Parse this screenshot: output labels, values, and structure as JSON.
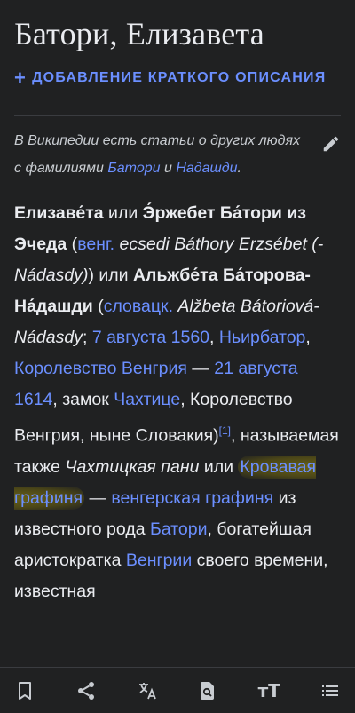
{
  "article": {
    "title": "Батори, Елизавета",
    "add_description": "Добавление краткого описания",
    "add_plus": "+",
    "hatnote": {
      "prefix": "В Википедии есть статьи о других людях с фамилиями ",
      "link1": "Батори",
      "mid": " и ",
      "link2": "Надашди",
      "suffix": "."
    },
    "lead": {
      "s1_bold": "Елизаве́та",
      "s2": " или ",
      "s3_bold": "Э́ржебет Ба́тори из Эчеда",
      "s4": " (",
      "s5_link": "венг.",
      "s6_italic": " ecsedi Báthory Erzsébet (-Nádasdy)",
      "s7": ") или ",
      "s8_bold": "Альжбе́та Ба́торова-На́дашди",
      "s9": " (",
      "s10_link": "словацк.",
      "s11_italic": " Alžbeta Bátoriová-Nádasdy",
      "s12": "; ",
      "s13_link": "7 августа 1560",
      "s14": ", ",
      "s15_link": "Ньирбатор",
      "s16": ", ",
      "s17_link": "Королевство Венгрия",
      "s18": " — ",
      "s19_link": "21 августа 1614",
      "s20": ", замок ",
      "s21_link": "Чахтице",
      "s22": ", Королевство Венгрия, ныне Словакия)",
      "s23_ref": "[1]",
      "s24": ", называемая также ",
      "s25_italic": "Чахтицкая пани",
      "s26": " или ",
      "s27_link_highlight": "Кровавая графиня",
      "s28": " — ",
      "s29_link": "венгерская графиня",
      "s30": " из известного рода ",
      "s31_link": "Батори",
      "s32": ", богатейшая аристократка ",
      "s33_link": "Венгрии",
      "s34": " своего времени, известная"
    }
  },
  "toolbar": {
    "icons": [
      "bookmark-icon",
      "share-icon",
      "translate-icon",
      "find-in-page-icon",
      "text-size-icon",
      "contents-icon"
    ],
    "text_size_label": "тТ"
  },
  "colors": {
    "background": "#202122",
    "text": "#eaecf0",
    "link": "#6b8fff",
    "highlight": "#8a7f18"
  }
}
